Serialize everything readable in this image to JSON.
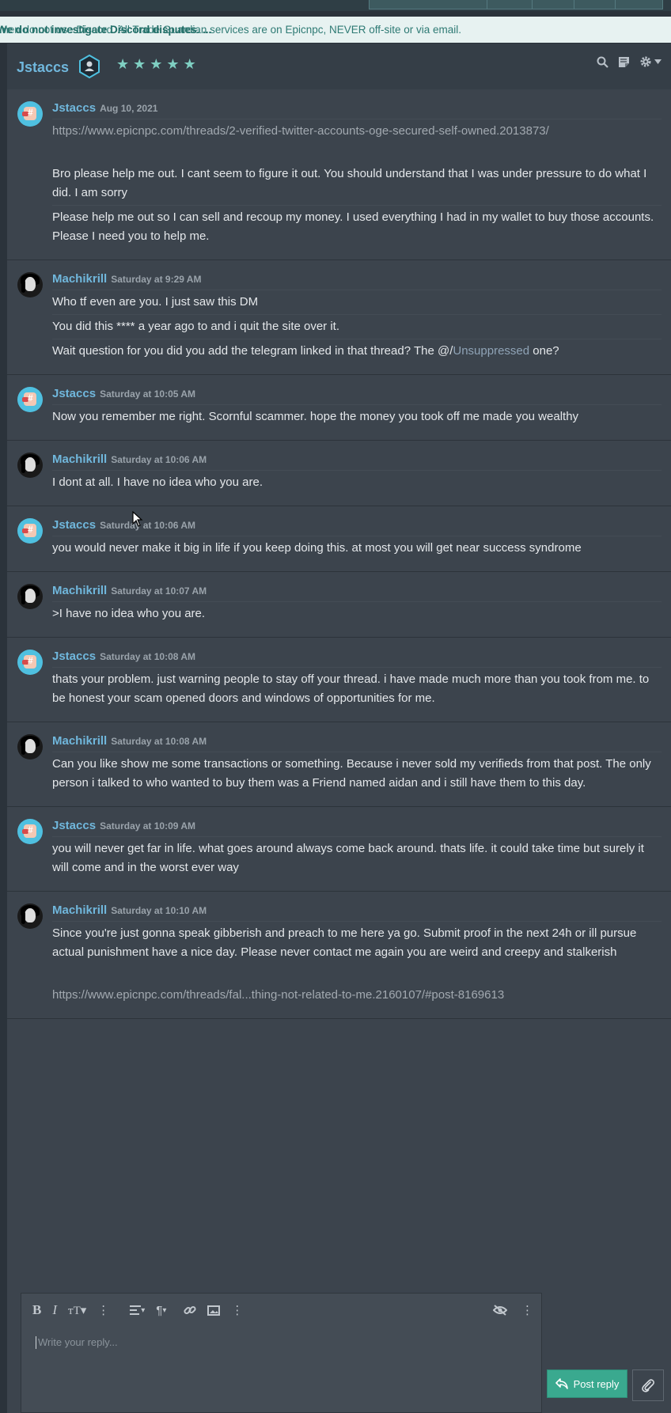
{
  "notice": {
    "text": "emen do not use Discord. All Trade Guardian services are on Epicnpc, NEVER off-site or via email.",
    "bold": "We do not investigate Discord disputes. ..."
  },
  "header": {
    "name": "Jstaccs",
    "stars": 5,
    "star_char": "★",
    "icons": [
      "search-icon",
      "note-icon",
      "gear-icon",
      "caret-down-icon"
    ]
  },
  "messages": [
    {
      "author": "Jstaccs",
      "avatar": "j",
      "time": "Aug 10, 2021",
      "lines": [
        {
          "text": "https://www.epicnpc.com/threads/2-verified-twitter-accounts-oge-secured-self-owned.2013873/",
          "link": true
        },
        {
          "text": "",
          "gap": true
        },
        {
          "text": "Bro please help me out. I cant seem to figure it out. You should understand that I was under pressure to do what I did. I am sorry"
        },
        {
          "text": "Please help me out so I can sell and recoup my money. I used everything I had in my wallet to buy those accounts. Please I need you to help me."
        }
      ]
    },
    {
      "author": "Machikrill",
      "avatar": "m",
      "time": "Saturday at 9:29 AM",
      "lines": [
        {
          "text": "Who tf even are you. I just saw this DM"
        },
        {
          "text": "You did this **** a year ago to and i quit the site over it."
        },
        {
          "text": "Wait question for you did you add the telegram linked in that thread? The @/",
          "mention": "Unsuppressed",
          "after": " one?"
        }
      ]
    },
    {
      "author": "Jstaccs",
      "avatar": "j",
      "time": "Saturday at 10:05 AM",
      "lines": [
        {
          "text": "Now you remember me right. Scornful scammer. hope the money you took off me made you wealthy"
        }
      ]
    },
    {
      "author": "Machikrill",
      "avatar": "m",
      "time": "Saturday at 10:06 AM",
      "lines": [
        {
          "text": "I dont at all. I have no idea who you are."
        }
      ]
    },
    {
      "author": "Jstaccs",
      "avatar": "j",
      "time": "Saturday at 10:06 AM",
      "lines": [
        {
          "text": "you would never make it big in life if you keep doing this. at most you will get near success syndrome"
        }
      ]
    },
    {
      "author": "Machikrill",
      "avatar": "m",
      "time": "Saturday at 10:07 AM",
      "lines": [
        {
          "text": ">I have no idea who you are."
        }
      ]
    },
    {
      "author": "Jstaccs",
      "avatar": "j",
      "time": "Saturday at 10:08 AM",
      "lines": [
        {
          "text": "thats your problem. just warning people to stay off your thread. i have made much more than you took from me. to be honest your scam opened doors and windows of opportunities for me."
        }
      ]
    },
    {
      "author": "Machikrill",
      "avatar": "m",
      "time": "Saturday at 10:08 AM",
      "lines": [
        {
          "text": "Can you like show me some transactions or something. Because i never sold my verifieds from that post. The only person i talked to who wanted to buy them was a Friend named aidan and i still have them to this day."
        }
      ]
    },
    {
      "author": "Jstaccs",
      "avatar": "j",
      "time": "Saturday at 10:09 AM",
      "lines": [
        {
          "text": "you will never get far in life. what goes around always come back around. thats life. it could take time but surely it will come and in the worst ever way"
        }
      ]
    },
    {
      "author": "Machikrill",
      "avatar": "m",
      "time": "Saturday at 10:10 AM",
      "lines": [
        {
          "text": "Since you're just gonna speak gibberish and preach to me here ya go. Submit proof in the next 24h or ill pursue actual punishment have a nice day. Please never contact me again you are weird and creepy and stalkerish"
        },
        {
          "text": "",
          "gap": true
        },
        {
          "text": "https://www.epicnpc.com/threads/fal...thing-not-related-to-me.2160107/#post-8169613",
          "link": true,
          "noborder": true
        }
      ]
    }
  ],
  "editor": {
    "placeholder": "Write your reply...",
    "post_label": "Post reply"
  },
  "colors": {
    "accent": "#3aa98f",
    "author": "#70b7dc",
    "panel": "#3c444d"
  }
}
